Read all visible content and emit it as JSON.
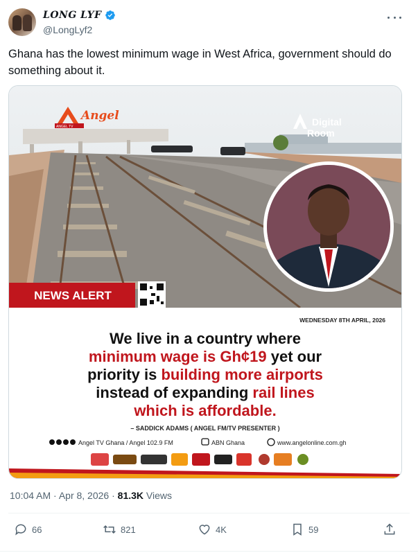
{
  "author": {
    "display_name": "LONG LYF",
    "handle": "@LongLyf2"
  },
  "tweet": {
    "text": "Ghana has the lowest minimum wage in West Africa, government should do something about it."
  },
  "media": {
    "brand_logo": "Angel",
    "brand_sub": "ANGEL TV",
    "digital_room_line1": "Digital",
    "digital_room_line2": "Room",
    "news_alert": "NEWS ALERT",
    "date": "WEDNESDAY 8TH APRIL, 2026",
    "quote_line1": "We live in a country where",
    "quote_line2_red": "minimum wage is Gh¢19",
    "quote_line2_black": " yet our",
    "quote_line3_black": "priority is ",
    "quote_line3_red": "building more airports",
    "quote_line4_black": "instead of expanding ",
    "quote_line4_red": "rail lines",
    "quote_line5_red": "which is affordable.",
    "attribution": "– SADDICK ADAMS ( ANGEL FM/TV PRESENTER )",
    "footer_social": "Angel TV Ghana / Angel 102.9 FM",
    "footer_abn": "ABN Ghana",
    "footer_web": "www.angelonline.com.gh",
    "colors": {
      "red": "#c0161d",
      "accent_orange": "#f39c12"
    }
  },
  "meta": {
    "time": "10:04 AM · Apr 8, 2026 · ",
    "views_count": "81.3K",
    "views_label": " Views"
  },
  "actions": {
    "replies": "66",
    "reposts": "821",
    "likes": "4K",
    "bookmarks": "59"
  }
}
